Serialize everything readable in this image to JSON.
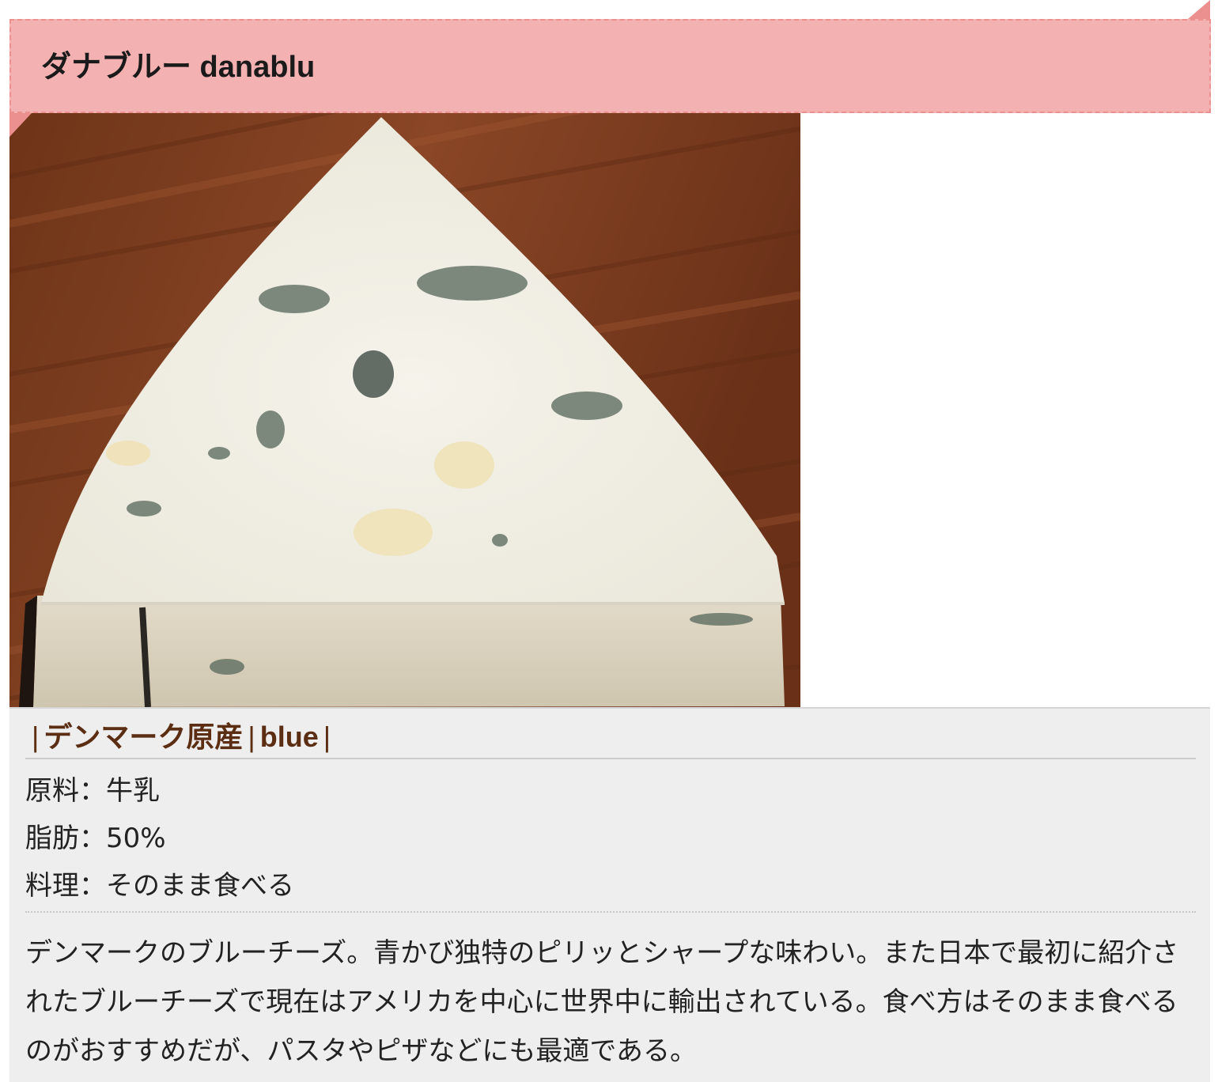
{
  "header": {
    "title": "ダナブルー danablu"
  },
  "image": {
    "alt": "ダナブルー danablu",
    "subject": "wedge of blue cheese on wooden board"
  },
  "tags": {
    "origin": "デンマーク原産",
    "type": "blue",
    "separator": "|"
  },
  "specs": [
    {
      "label": "原料",
      "value": "牛乳"
    },
    {
      "label": "脂肪",
      "value": "50%"
    },
    {
      "label": "料理",
      "value": "そのまま食べる"
    }
  ],
  "spec_separator": "：",
  "description": "デンマークのブルーチーズ。青かび独特のピリッとシャープな味わい。また日本で最初に紹介されたブルーチーズで現在はアメリカを中心に世界中に輸出されている。食べ方はそのまま食べるのがおすすめだが、パスタやピザなどにも最適である。",
  "colors": {
    "ribbon": "#f4b1b1",
    "ribbon_border": "#ec8f8f",
    "tag_text": "#5b2d12",
    "panel_bg": "#eeeeee"
  }
}
